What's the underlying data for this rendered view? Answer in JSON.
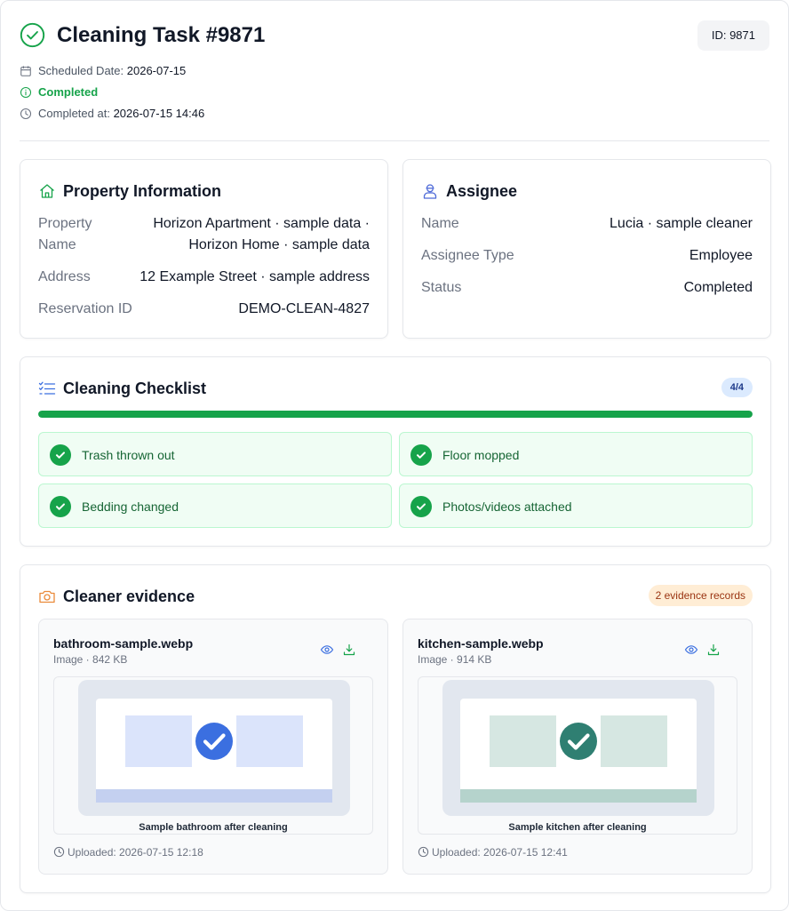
{
  "header": {
    "title": "Cleaning Task #9871",
    "id_badge": "ID: 9871",
    "scheduled_label": "Scheduled Date:",
    "scheduled_value": "2026-07-15",
    "status": "Completed",
    "completed_label": "Completed at:",
    "completed_value": "2026-07-15 14:46"
  },
  "property": {
    "title": "Property Information",
    "rows": [
      {
        "key_line1": "Property",
        "key_line2": "Name",
        "value_line1": "Horizon Apartment · sample data ·",
        "value_line2": "Horizon Home · sample data"
      },
      {
        "key": "Address",
        "value": "12 Example Street · sample address"
      },
      {
        "key": "Reservation ID",
        "value": "DEMO-CLEAN-4827"
      }
    ]
  },
  "assignee": {
    "title": "Assignee",
    "rows": [
      {
        "key": "Name",
        "value": "Lucia · sample cleaner"
      },
      {
        "key": "Assignee Type",
        "value": "Employee"
      },
      {
        "key": "Status",
        "value": "Completed"
      }
    ]
  },
  "checklist": {
    "title": "Cleaning Checklist",
    "badge": "4/4",
    "progress_fraction": 1.0,
    "items": [
      {
        "label": "Trash thrown out",
        "done": true
      },
      {
        "label": "Floor mopped",
        "done": true
      },
      {
        "label": "Bedding changed",
        "done": true
      },
      {
        "label": "Photos/videos attached",
        "done": true
      }
    ]
  },
  "evidence": {
    "title": "Cleaner evidence",
    "badge": "2 evidence records",
    "items": [
      {
        "filename": "bathroom-sample.webp",
        "meta": "Image · 842 KB",
        "caption": "Sample bathroom after cleaning",
        "uploaded": "Uploaded: 2026-07-15 12:18",
        "panel_color": "#dbe4fb",
        "stripe_color": "#c4d0f0",
        "check_color": "#3b6fe0"
      },
      {
        "filename": "kitchen-sample.webp",
        "meta": "Image · 914 KB",
        "caption": "Sample kitchen after cleaning",
        "uploaded": "Uploaded: 2026-07-15 12:41",
        "panel_color": "#d6e7e2",
        "stripe_color": "#b5d3cc",
        "check_color": "#2f7f72"
      }
    ]
  },
  "colors": {
    "success": "#16a34a",
    "accent_blue": "#3b6fe0",
    "evidence_badge": "#ffedd5"
  }
}
